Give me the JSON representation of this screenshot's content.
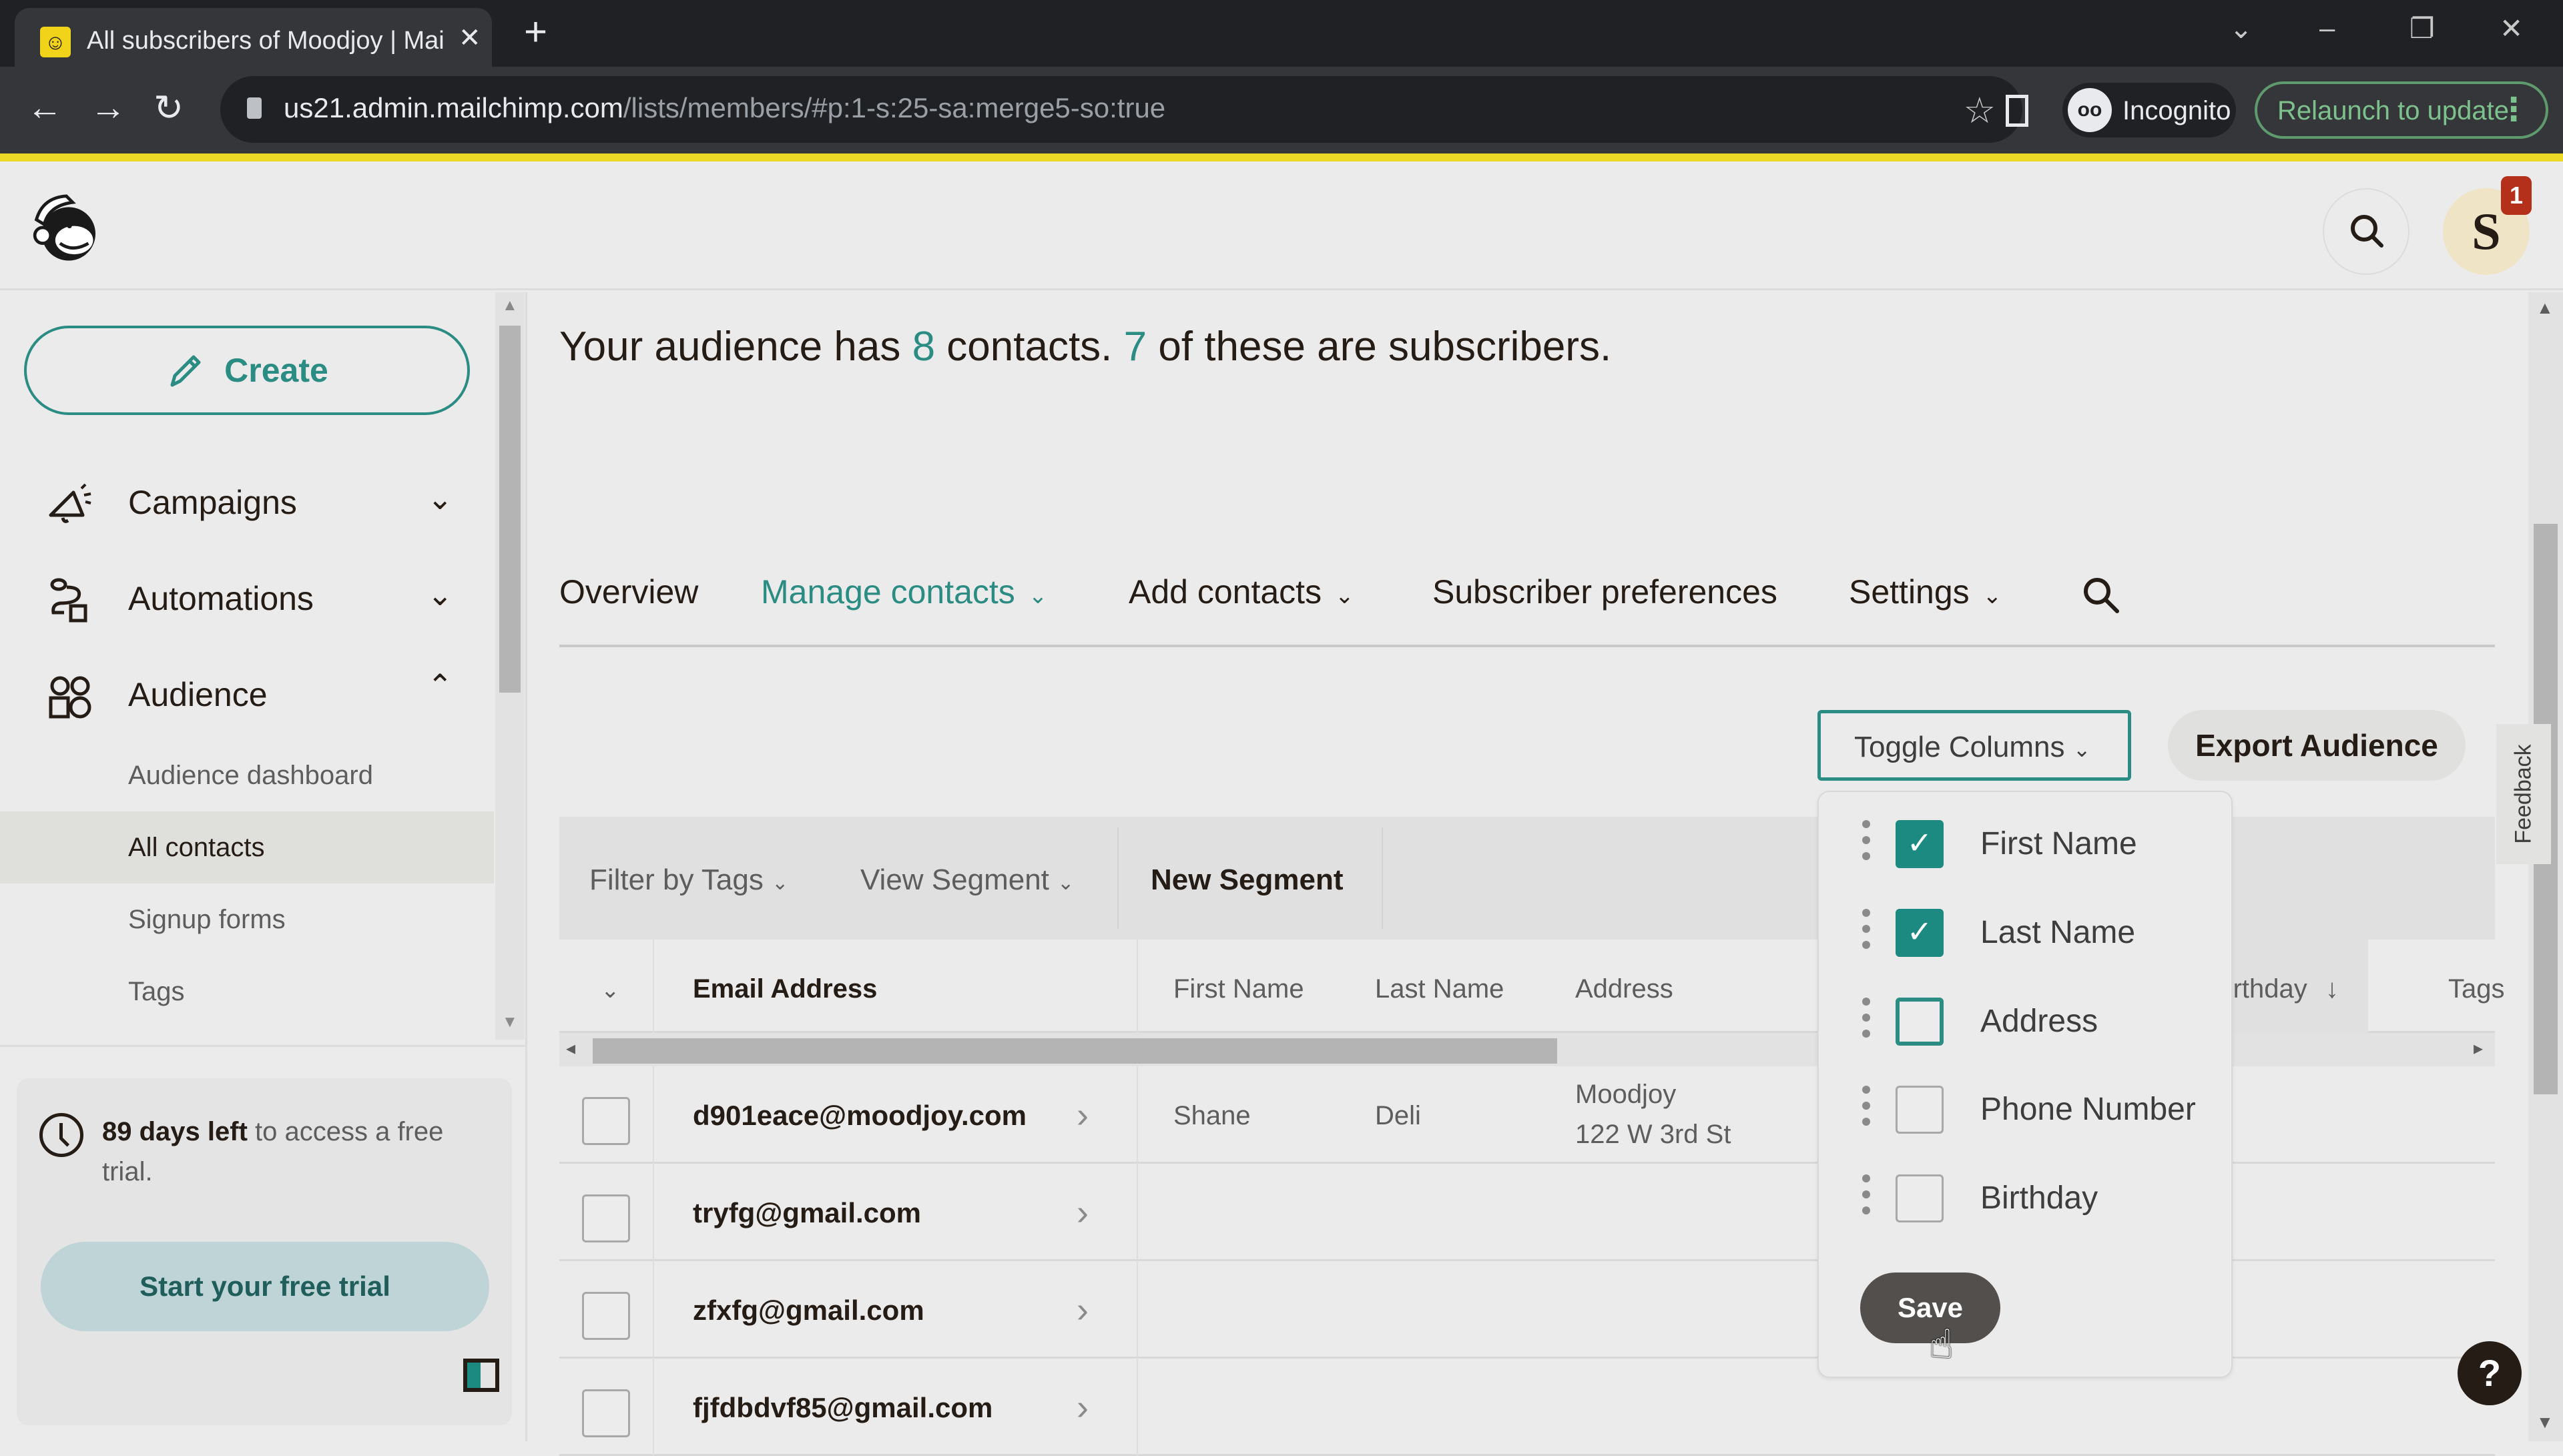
{
  "browser": {
    "tab_title": "All subscribers of Moodjoy | Mai",
    "tab_favicon": "mailchimp-favicon",
    "url_host": "us21.admin.mailchimp.com",
    "url_path": "/lists/members/#p:1-s:25-sa:merge5-so:true",
    "incognito_label": "Incognito",
    "relaunch_label": "Relaunch to update"
  },
  "header": {
    "avatar_initial": "S",
    "notification_count": "1"
  },
  "sidebar": {
    "create_label": "Create",
    "nav": [
      {
        "label": "Campaigns",
        "icon": "megaphone-icon",
        "expanded": false
      },
      {
        "label": "Automations",
        "icon": "automation-flow-icon",
        "expanded": false
      },
      {
        "label": "Audience",
        "icon": "audience-icon",
        "expanded": true
      }
    ],
    "audience_subitems": [
      {
        "label": "Audience dashboard",
        "active": false
      },
      {
        "label": "All contacts",
        "active": true
      },
      {
        "label": "Signup forms",
        "active": false
      },
      {
        "label": "Tags",
        "active": false
      }
    ],
    "trial": {
      "days_bold": "89 days left",
      "rest": " to access a free trial.",
      "button_label": "Start your free trial"
    }
  },
  "main": {
    "summary": {
      "prefix": "Your audience has ",
      "contacts": "8",
      "middle": " contacts. ",
      "subscribers": "7",
      "suffix": " of these are subscribers."
    },
    "tabs": [
      {
        "label": "Overview",
        "dropdown": false,
        "active": false
      },
      {
        "label": "Manage contacts",
        "dropdown": true,
        "active": true
      },
      {
        "label": "Add contacts",
        "dropdown": true,
        "active": false
      },
      {
        "label": "Subscriber preferences",
        "dropdown": false,
        "active": false
      },
      {
        "label": "Settings",
        "dropdown": true,
        "active": false
      }
    ],
    "toggle_columns_label": "Toggle Columns",
    "export_label": "Export Audience",
    "filters": {
      "filter_by_tags": "Filter by Tags",
      "view_segment": "View Segment",
      "new_segment": "New Segment"
    },
    "table": {
      "columns": [
        "Email Address",
        "First Name",
        "Last Name",
        "Address",
        "Birthday",
        "Tags"
      ],
      "sorted_column": "Birthday",
      "sort_direction_icon": "↓",
      "rows": [
        {
          "email": "d901eace@moodjoy.com",
          "first_name": "Shane",
          "last_name": "Deli",
          "address_line1": "Moodjoy",
          "address_line2": "122 W 3rd St"
        },
        {
          "email": "tryfg@gmail.com",
          "first_name": "",
          "last_name": "",
          "address_line1": "",
          "address_line2": ""
        },
        {
          "email": "zfxfg@gmail.com",
          "first_name": "",
          "last_name": "",
          "address_line1": "",
          "address_line2": ""
        },
        {
          "email": "fjfdbdvf85@gmail.com",
          "first_name": "",
          "last_name": "",
          "address_line1": "",
          "address_line2": ""
        }
      ]
    },
    "column_toggle_menu": {
      "items": [
        {
          "label": "First Name",
          "checked": true
        },
        {
          "label": "Last Name",
          "checked": true
        },
        {
          "label": "Address",
          "checked": false
        },
        {
          "label": "Phone Number",
          "checked": false
        },
        {
          "label": "Birthday",
          "checked": false
        }
      ],
      "save_label": "Save"
    }
  },
  "feedback_label": "Feedback",
  "help_label": "?",
  "colors": {
    "accent": "#2a8c82",
    "checkbox_fill": "#1c8a80",
    "brand_yellow": "#ecd927",
    "badge_red": "#b5301a"
  }
}
